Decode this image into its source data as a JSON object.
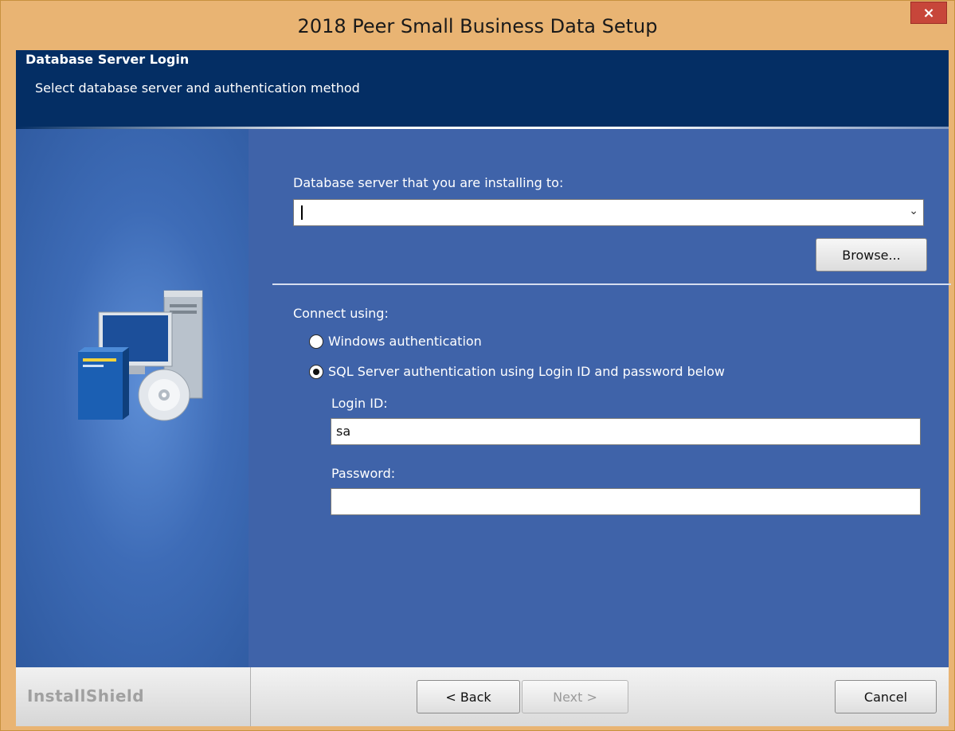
{
  "window": {
    "title": "2018 Peer Small Business Data Setup",
    "close_glyph": "×"
  },
  "header": {
    "title": "Database Server Login",
    "subtitle": "Select database server and authentication method"
  },
  "server": {
    "label": "Database server that you are installing to:",
    "value": "",
    "dropdown_glyph": "⌄",
    "browse_label": "Browse..."
  },
  "auth": {
    "connect_label": "Connect using:",
    "options": [
      {
        "label": "Windows authentication",
        "selected": false
      },
      {
        "label": "SQL Server authentication using Login ID and password below",
        "selected": true
      }
    ],
    "login_label": "Login ID:",
    "login_value": "sa",
    "password_label": "Password:",
    "password_value": ""
  },
  "footer": {
    "brand": "InstallShield",
    "back_label": "< Back",
    "next_label": "Next >",
    "cancel_label": "Cancel"
  },
  "colors": {
    "header_bg": "#042e64",
    "panel_bg": "#3f63a9",
    "frame": "#e9b473",
    "close_bg": "#c7463a"
  },
  "icons": [
    "close-icon",
    "chevron-down-icon",
    "computer-cd-icon"
  ]
}
